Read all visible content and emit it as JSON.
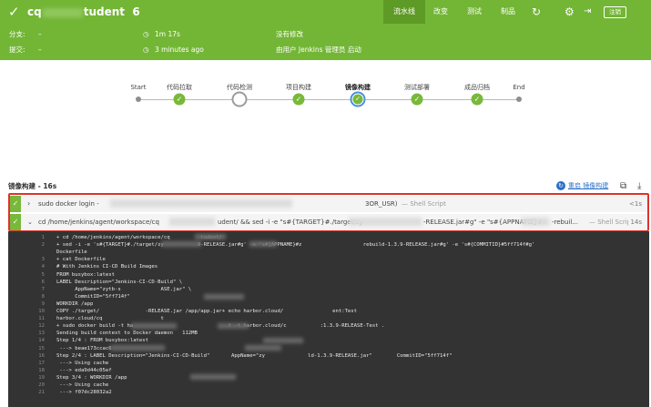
{
  "header": {
    "title_prefix": "cq",
    "title_suffix": "tudent",
    "run_number": "6",
    "nav": [
      "流水线",
      "改变",
      "测试",
      "制品"
    ],
    "logout_label": "注销"
  },
  "sub": {
    "branch_label": "分支:",
    "branch_value": "–",
    "commit_label": "提交:",
    "commit_value": "–",
    "duration": "1m 17s",
    "finished": "3 minutes ago",
    "changes": "没有修改",
    "trigger": "由用户 Jenkins 管理员 启动"
  },
  "stages": [
    "Start",
    "代码拉取",
    "代码检测",
    "项目构建",
    "镜像构建",
    "测试部署",
    "成品归档",
    "End"
  ],
  "section": {
    "title": "镜像构建 - 16s",
    "restart": "重启 镜像构建"
  },
  "steps": [
    {
      "cmd_start": "sudo docker login -",
      "cmd_end": "3OR_USR)",
      "shell": "— Shell Script",
      "dur": "<1s"
    },
    {
      "cmd_start": "cd /home/jenkins/agent/workspace/cq",
      "cmd_mid": "udent/ && sed -i -e \"s#{TARGET}#./target/zy",
      "cmd_mid2": "-RELEASE.jar#g\" -e \"s#{APPNAME}#.",
      "cmd_end": "-rebuil...",
      "shell": "— Shell Script",
      "dur": "14s"
    }
  ],
  "console": [
    {
      "n": "1",
      "t": "+ cd /home/jenkins/agent/workspace/cq          tudent/"
    },
    {
      "n": "2",
      "t": "+ sed -i -e 's#{TARGET}#./target/zy          .9-RELEASE.jar#g' -e 's#{APPNAME}#z                    rebuild-1.3.9-RELEASE.jar#g' -e 's#{COMMITID}#5ff714f#g'"
    },
    {
      "n": "",
      "t": "Dockerfile"
    },
    {
      "n": "3",
      "t": "+ cat Dockerfile"
    },
    {
      "n": "4",
      "t": "# With Jenkins CI-CD Build Images"
    },
    {
      "n": "5",
      "t": "FROM busybox:latest"
    },
    {
      "n": "6",
      "t": "LABEL Description=\"Jenkins-CI-CD-Build\" \\"
    },
    {
      "n": "7",
      "t": "      AppName=\"zytb-s             ASE.jar\" \\"
    },
    {
      "n": "8",
      "t": "      CommitID=\"5ff714f\""
    },
    {
      "n": "9",
      "t": "WORKDIR /app"
    },
    {
      "n": "10",
      "t": "COPY ./target/               -RELEASE.jar /app/app.jar+ echo harbor.cloud/                ent:Test"
    },
    {
      "n": "11",
      "t": "harbor.cloud/cq                   t"
    },
    {
      "n": "12",
      "t": "+ sudo docker build -t ha                              .t -t harbor.cloud/c           :1.3.9-RELEASE-Test ."
    },
    {
      "n": "13",
      "t": "Sending build context to Docker daemon   112MB"
    },
    {
      "n": "14",
      "t": "Step 1/4 : FROM busybox:latest"
    },
    {
      "n": "15",
      "t": " ---> beae173ccac6"
    },
    {
      "n": "16",
      "t": "Step 2/4 : LABEL Description=\"Jenkins-CI-CD-Build\"       AppName=\"zy              ld-1.3.9-RELEASE.jar\"        CommitID=\"5ff714f\""
    },
    {
      "n": "17",
      "t": " ---> Using cache"
    },
    {
      "n": "18",
      "t": " ---> eda9d44c05ef"
    },
    {
      "n": "19",
      "t": "Step 3/4 : WORKDIR /app"
    },
    {
      "n": "20",
      "t": " ---> Using cache"
    },
    {
      "n": "21",
      "t": " ---> f07dc28032a2"
    }
  ],
  "colors": {
    "header_green": "#73b636",
    "active_tab": "#5e9a26",
    "highlight_red": "#e0312a",
    "console_bg": "#333333"
  }
}
